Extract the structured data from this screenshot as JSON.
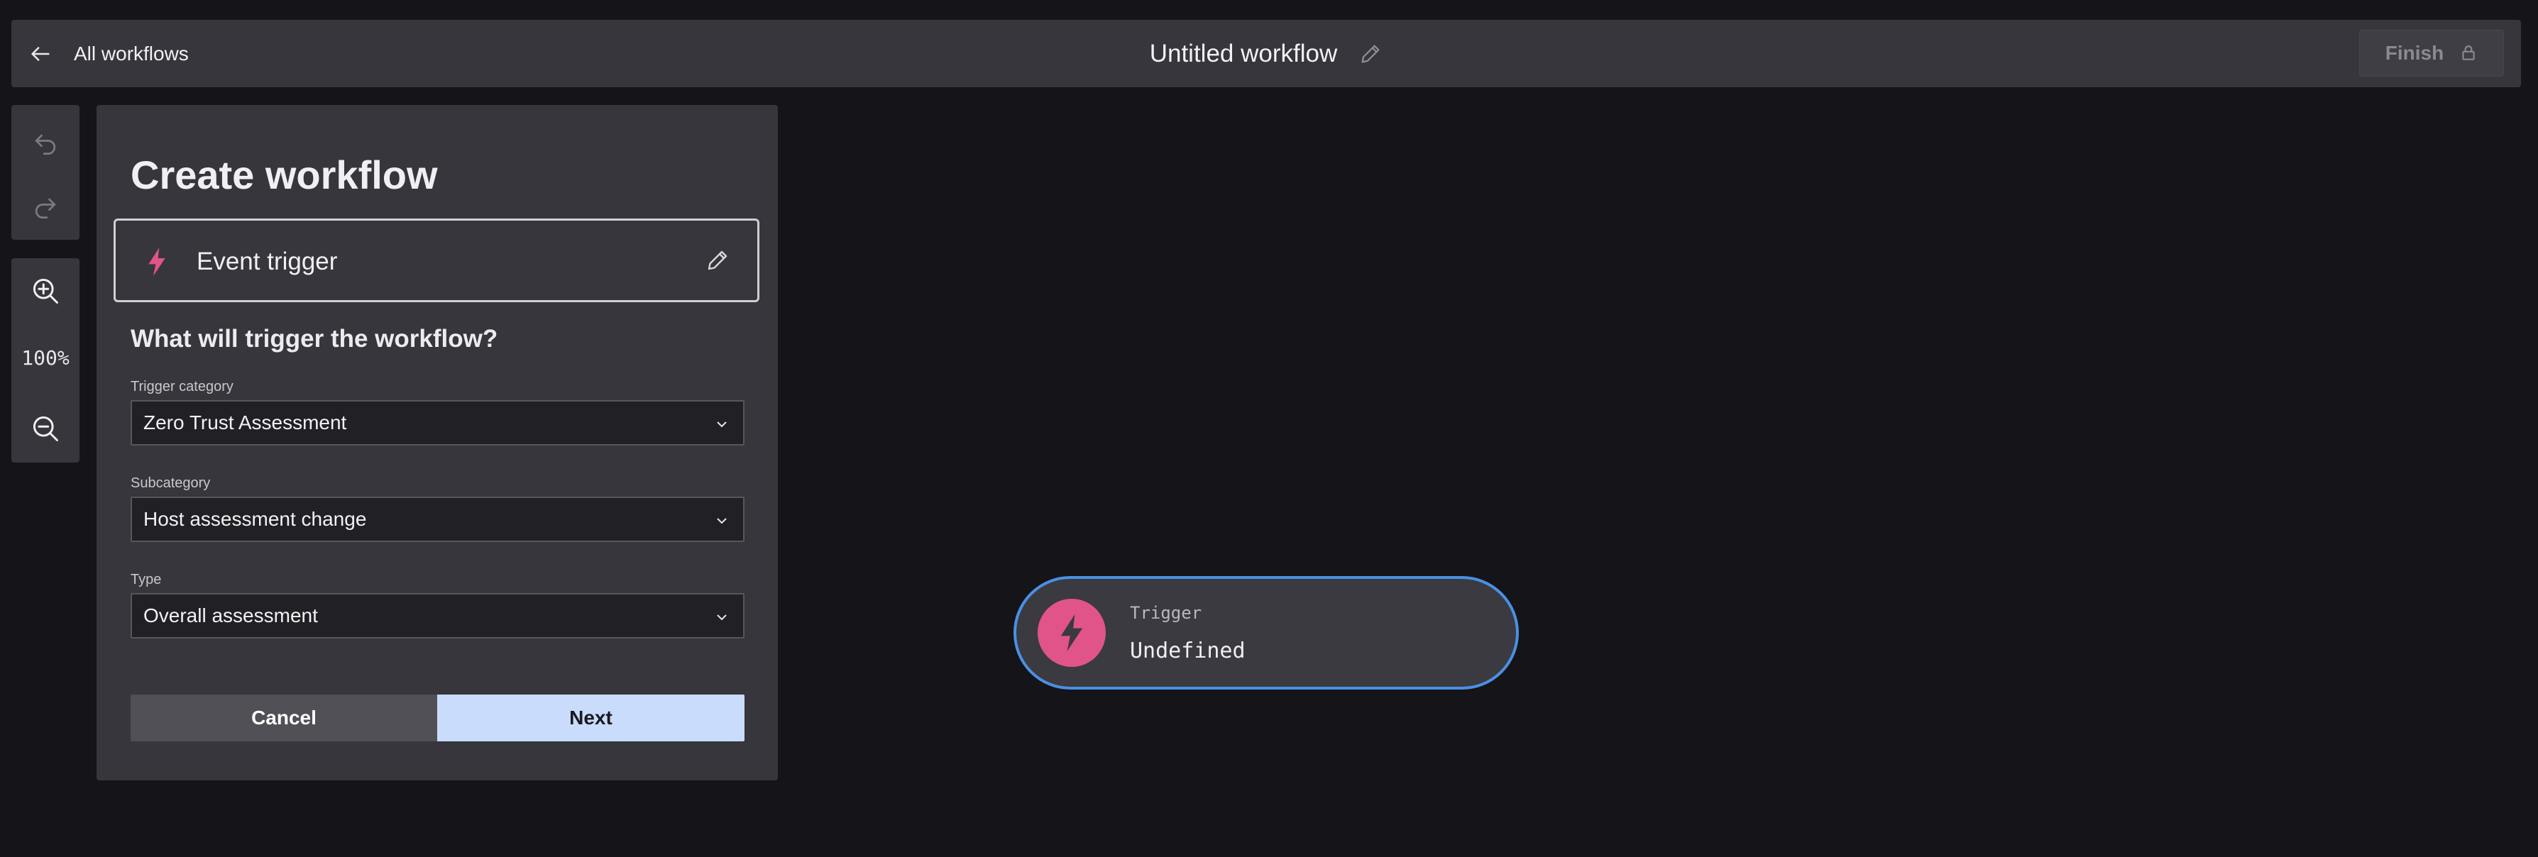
{
  "header": {
    "back_label": "All workflows",
    "title": "Untitled workflow",
    "finish_label": "Finish",
    "back_icon": "arrow-left-icon",
    "edit_icon": "pencil-icon",
    "finish_icon": "lock-icon"
  },
  "toolbar": {
    "undo_icon": "undo-icon",
    "redo_icon": "redo-icon",
    "zoom_in_icon": "zoom-in-icon",
    "zoom_out_icon": "zoom-out-icon",
    "zoom_level": "100%"
  },
  "panel": {
    "title": "Create workflow",
    "trigger_card": {
      "label": "Event trigger",
      "icon": "lightning-bolt-icon",
      "edit_icon": "pencil-icon"
    },
    "question": "What will trigger the workflow?",
    "fields": [
      {
        "label": "Trigger category",
        "value": "Zero Trust Assessment"
      },
      {
        "label": "Subcategory",
        "value": "Host assessment change"
      },
      {
        "label": "Type",
        "value": "Overall assessment"
      }
    ],
    "cancel_label": "Cancel",
    "next_label": "Next"
  },
  "canvas": {
    "node": {
      "kind": "Trigger",
      "value": "Undefined",
      "icon": "lightning-bolt-icon"
    }
  },
  "colors": {
    "background": "#141419",
    "surface": "#36363c",
    "accent_pink": "#e0548a",
    "node_border": "#4a90e2",
    "next_button": "#c9dcfb",
    "cancel_button": "#505056"
  }
}
